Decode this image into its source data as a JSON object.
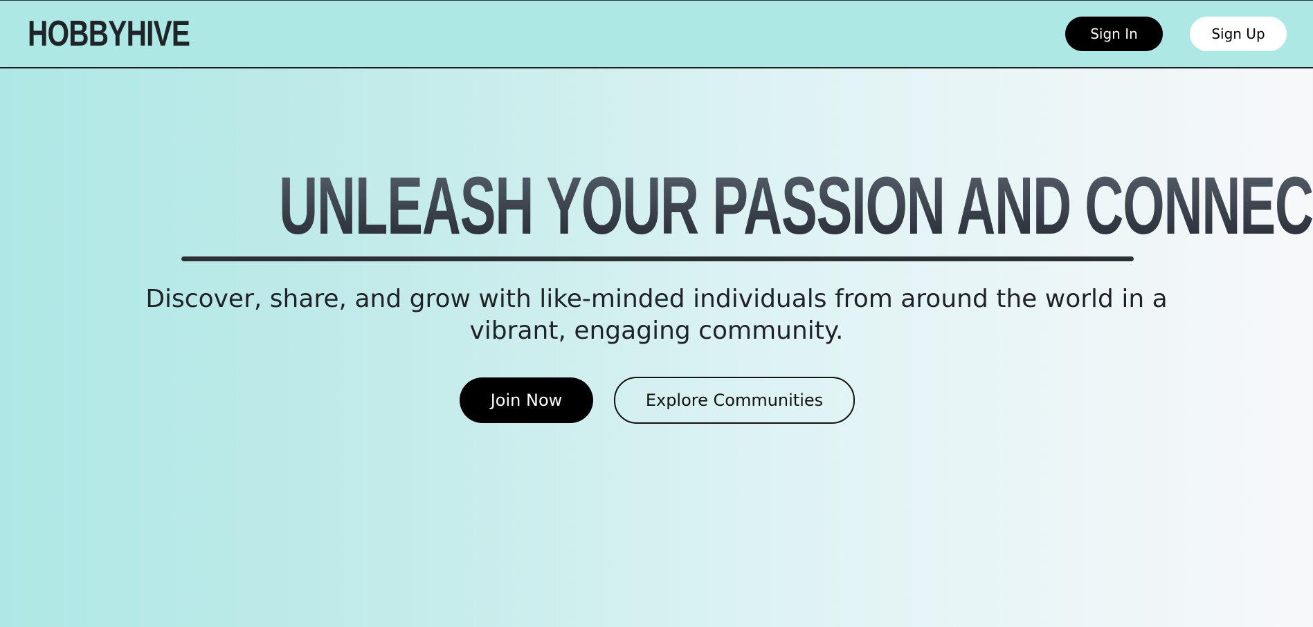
{
  "navbar": {
    "brand": "HOBBYHIVE",
    "sign_in_label": "Sign In",
    "sign_up_label": "Sign Up"
  },
  "hero": {
    "title": "UNLEASH YOUR PASSION AND CONNECT!",
    "subtitle": "Discover, share, and grow with like-minded individuals from around the world in a vibrant, engaging community.",
    "join_label": "Join Now",
    "explore_label": "Explore Communities"
  },
  "colors": {
    "background_start": "#aee8e6",
    "background_end": "#f7f8fa",
    "primary_button": "#000000",
    "text_dark": "#1f2328"
  }
}
